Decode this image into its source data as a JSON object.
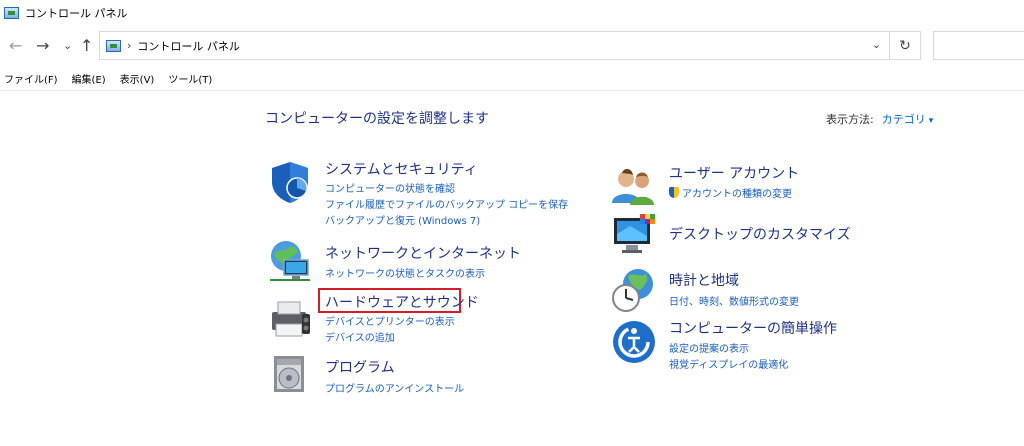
{
  "window": {
    "title": "コントロール パネル"
  },
  "nav": {
    "back": "←",
    "forward": "→",
    "recent": "⌄",
    "up": "↑"
  },
  "address": {
    "crumb": "コントロール パネル",
    "separator": "›",
    "dropdown": "⌄",
    "refresh": "↻"
  },
  "menu": {
    "items": [
      "ファイル(F)",
      "編集(E)",
      "表示(V)",
      "ツール(T)"
    ]
  },
  "main": {
    "heading": "コンピューターの設定を調整します",
    "view_by_label": "表示方法:",
    "view_by_value": "カテゴリ",
    "view_by_caret": "▾"
  },
  "categories": {
    "system": {
      "title": "システムとセキュリティ",
      "links": [
        "コンピューターの状態を確認",
        "ファイル履歴でファイルのバックアップ コピーを保存",
        "バックアップと復元 (Windows 7)"
      ],
      "icon": "shield-icon"
    },
    "network": {
      "title": "ネットワークとインターネット",
      "links": [
        "ネットワークの状態とタスクの表示"
      ],
      "icon": "network-globe-icon"
    },
    "hardware": {
      "title": "ハードウェアとサウンド",
      "links": [
        "デバイスとプリンターの表示",
        "デバイスの追加"
      ],
      "icon": "printer-icon"
    },
    "programs": {
      "title": "プログラム",
      "links": [
        "プログラムのアンインストール"
      ],
      "icon": "programs-disc-icon"
    },
    "users": {
      "title": "ユーザー アカウント",
      "links": [
        "アカウントの種類の変更"
      ],
      "icon": "users-icon"
    },
    "appearance": {
      "title": "デスクトップのカスタマイズ",
      "links": [],
      "icon": "monitor-palette-icon"
    },
    "clock": {
      "title": "時計と地域",
      "links": [
        "日付、時刻、数値形式の変更"
      ],
      "icon": "clock-globe-icon"
    },
    "ease": {
      "title": "コンピューターの簡単操作",
      "links": [
        "設定の提案の表示",
        "視覚ディスプレイの最適化"
      ],
      "icon": "ease-of-access-icon"
    }
  },
  "colors": {
    "title_blue": "#1e3287",
    "link_blue": "#1a5dbf",
    "highlight_red": "#d01f2a"
  }
}
